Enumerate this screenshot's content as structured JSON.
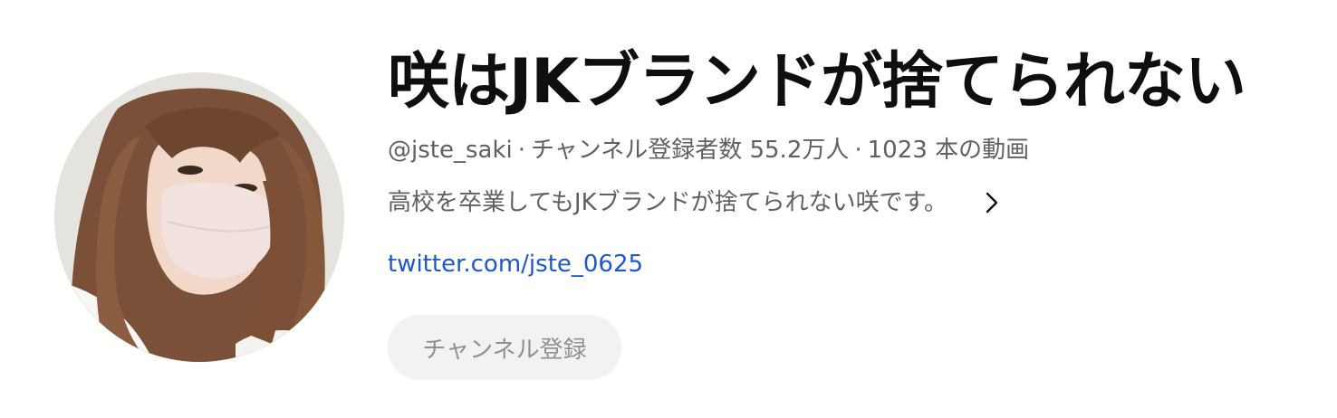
{
  "channel": {
    "name": "咲はJKブランドが捨てられない",
    "handle": "@jste_saki",
    "separator": "·",
    "subscribers": "チャンネル登録者数 55.2万人",
    "videos": "1023 本の動画",
    "description": "高校を卒業してもJKブランドが捨てられない咲です。",
    "link": "twitter.com/jste_0625",
    "subscribe_label": "チャンネル登録"
  },
  "icons": {
    "description_expand": "chevron-right-icon"
  },
  "colors": {
    "title": "#0f0f0f",
    "secondary_text": "#606060",
    "link": "#1f57c9",
    "button_bg": "#f2f2f2",
    "button_text": "#909090"
  }
}
